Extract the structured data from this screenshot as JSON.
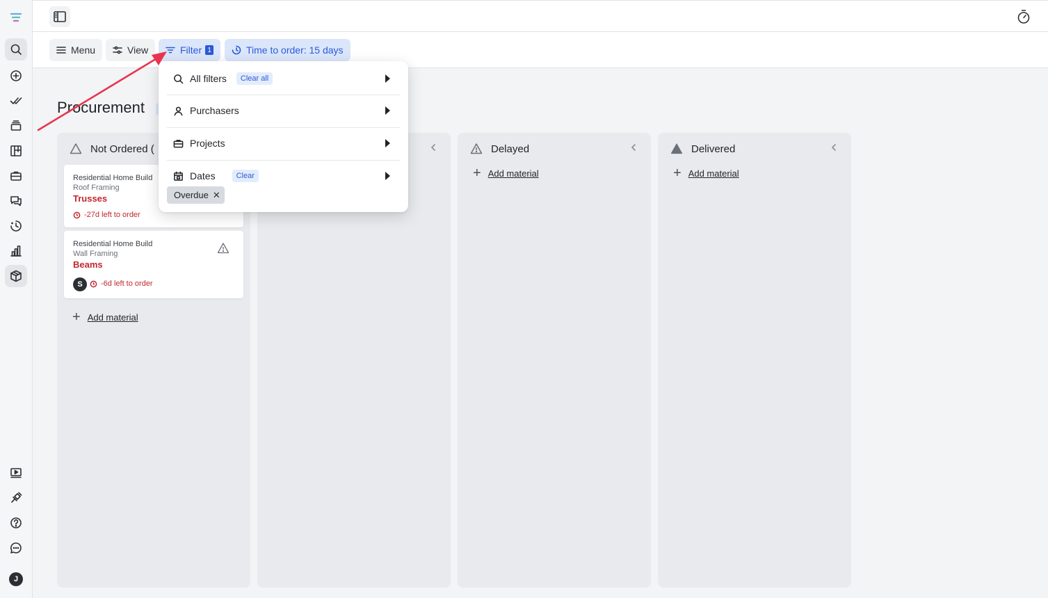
{
  "toolbar": {
    "menu_label": "Menu",
    "view_label": "View",
    "filter_label": "Filter",
    "filter_count": "1",
    "time_label": "Time to order: 15 days"
  },
  "page": {
    "title": "Procurement"
  },
  "columns": [
    {
      "title": "Not Ordered (",
      "icon": "warning-outline-icon",
      "add_label": "Add material"
    },
    {
      "title": "",
      "icon": "",
      "add_label": ""
    },
    {
      "title": "Delayed",
      "icon": "warning-outline-icon",
      "add_label": "Add material"
    },
    {
      "title": "Delivered",
      "icon": "triangle-filled-icon",
      "add_label": "Add material"
    }
  ],
  "cards": [
    {
      "project": "Residential Home Build",
      "phase": "Roof Framing",
      "material": "Trusses",
      "due": "-27d left to order"
    },
    {
      "project": "Residential Home Build",
      "phase": "Wall Framing",
      "material": "Beams",
      "due": "-6d left to order",
      "assignee": "S"
    }
  ],
  "filter_menu": {
    "rows": [
      {
        "label": "All filters",
        "icon": "search-icon",
        "pill": "Clear all"
      },
      {
        "label": "Purchasers",
        "icon": "user-icon"
      },
      {
        "label": "Projects",
        "icon": "briefcase-icon"
      },
      {
        "label": "Dates",
        "icon": "calendar-icon",
        "pill": "Clear"
      }
    ],
    "chip": "Overdue"
  },
  "user": {
    "initial": "J"
  },
  "colors": {
    "accent": "#2a5bd7",
    "danger": "#c1272d",
    "annotation_arrow": "#e8344e"
  }
}
